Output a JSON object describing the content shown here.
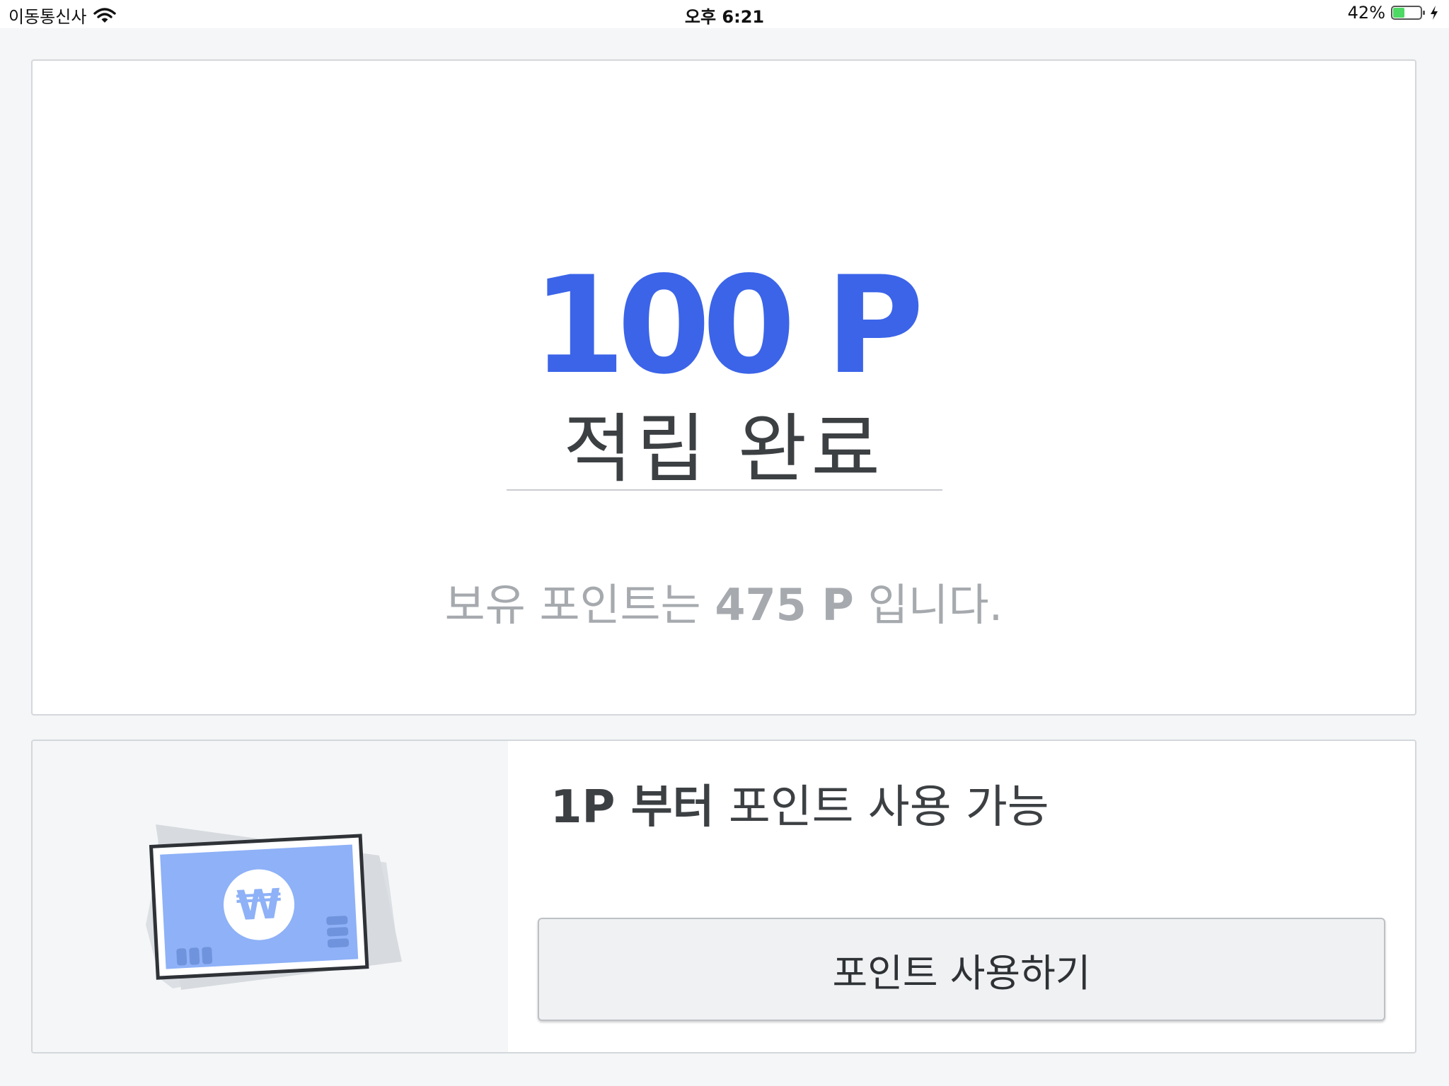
{
  "status_bar": {
    "carrier": "이동통신사",
    "time": "오후 6:21",
    "battery_percent": "42%",
    "battery_level": 0.42,
    "icons": [
      "wifi-icon",
      "battery-icon",
      "charging-bolt-icon"
    ]
  },
  "result": {
    "points_earned": "100 P",
    "earned_label": "적립 완료",
    "balance_prefix": "보유 포인트는",
    "balance_value": "475 P",
    "balance_suffix": "입니다."
  },
  "usage": {
    "min_label": "1P 부터",
    "info_label": "포인트 사용 가능",
    "button_label": "포인트 사용하기",
    "illustration_icon": "won-banknote-icon"
  },
  "colors": {
    "accent": "#3b64e8",
    "text_dark": "#3c4043",
    "text_muted": "#a6aaae",
    "background": "#f4f6f7",
    "banknote_fill": "#8eb1f7"
  }
}
